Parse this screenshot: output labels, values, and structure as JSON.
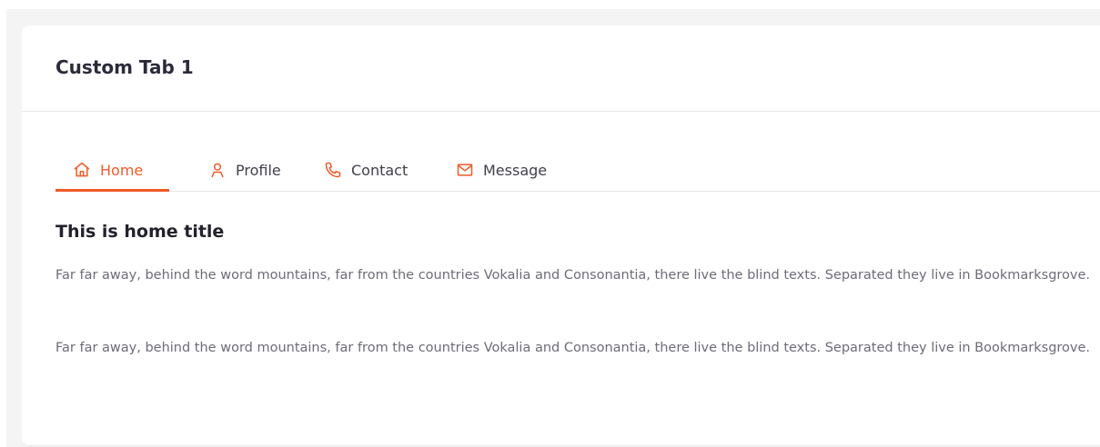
{
  "card": {
    "title": "Custom Tab 1"
  },
  "tabs": [
    {
      "label": "Home",
      "icon": "home-icon",
      "active": true
    },
    {
      "label": "Profile",
      "icon": "user-icon",
      "active": false
    },
    {
      "label": "Contact",
      "icon": "phone-icon",
      "active": false
    },
    {
      "label": "Message",
      "icon": "mail-icon",
      "active": false
    }
  ],
  "content": {
    "title": "This is home title",
    "paragraphs": [
      "Far far away, behind the word mountains, far from the countries Vokalia and Consonantia, there live the blind texts. Separated they live in Bookmarksgrove.",
      "Far far away, behind the word mountains, far from the countries Vokalia and Consonantia, there live the blind texts. Separated they live in Bookmarksgrove."
    ]
  },
  "colors": {
    "accent": "#f05a28",
    "text_dark": "#2b2b3b",
    "text_muted": "#6c6c78"
  }
}
